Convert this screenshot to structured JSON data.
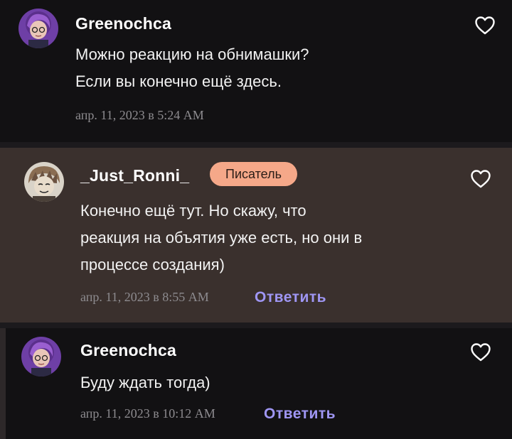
{
  "comments": [
    {
      "author": "Greenochca",
      "badge": "",
      "lines": [
        "Можно реакцию на обнимашки?",
        "Если вы конечно ещё здесь."
      ],
      "timestamp": "апр. 11, 2023 в 5:24 AM",
      "reply_label": "",
      "liked": false
    },
    {
      "author": "_Just_Ronni_",
      "badge": "Писатель",
      "lines": [
        "Конечно ещё тут. Но скажу, что",
        "реакция на объятия уже есть, но они в",
        "процессе создания)"
      ],
      "timestamp": "апр. 11, 2023 в 8:55 AM",
      "reply_label": "Ответить",
      "liked": false
    },
    {
      "author": "Greenochca",
      "badge": "",
      "lines": [
        "Буду ждать тогда)"
      ],
      "timestamp": "апр. 11, 2023 в 10:12 AM",
      "reply_label": "Ответить",
      "liked": false
    }
  ],
  "icons": {
    "like": "heart-outline-icon",
    "avatar_greenochca": "avatar-purple-hair",
    "avatar_ronni": "avatar-sketch-boy"
  },
  "colors": {
    "background": "#121113",
    "highlight_background": "#3a302d",
    "badge_background": "#f5a889",
    "reply_accent": "#9f96f4",
    "meta_text": "#8d8b8f"
  }
}
